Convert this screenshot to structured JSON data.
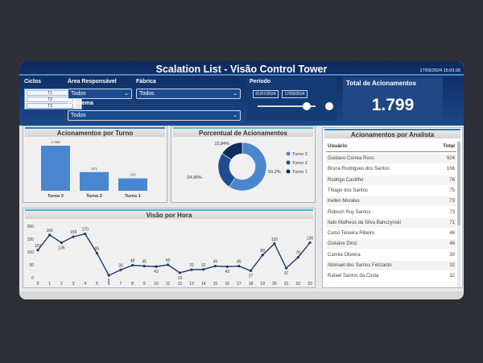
{
  "header": {
    "title": "Scalation List - Visão Control Tower",
    "timestamp": "17/09/2024 15:03:26"
  },
  "filters": {
    "ciclos_label": "Ciclos",
    "ciclos_items": [
      "T1",
      "T2",
      "T3"
    ],
    "area_label": "Área Responsável",
    "area_value": "Todos",
    "fabrica_label": "Fábrica",
    "fabrica_value": "Todos",
    "problema_label": "Problema",
    "problema_value": "Todos",
    "periodo_label": "Período",
    "periodo_start": "01/07/2024",
    "periodo_end": "17/09/2024"
  },
  "total": {
    "label": "Total de Acionamentos",
    "value": "1.799"
  },
  "panels": {
    "turno_title": "Acionamentos por Turno",
    "percent_title": "Porcentual de Acionamentos",
    "analista_title": "Acionamentos por Analista",
    "hora_title": "Visão por Hora"
  },
  "table": {
    "col_usuario": "Usuário",
    "col_total": "Total",
    "rows": [
      {
        "name": "Gustavo Correa Ross",
        "total": "924"
      },
      {
        "name": "Bruna Rodrigues dos Santos",
        "total": "166"
      },
      {
        "name": "Rodrigo Castilho",
        "total": "76"
      },
      {
        "name": "Thiago dos Santos",
        "total": "75"
      },
      {
        "name": "Kellen Morales",
        "total": "73"
      },
      {
        "name": "Robson Ruy Santos",
        "total": "73"
      },
      {
        "name": "Italo Matheus da Silva Banczynski",
        "total": "71"
      },
      {
        "name": "Celso Teixeira Ribeiro",
        "total": "46"
      },
      {
        "name": "Gislaine Diniz",
        "total": "46"
      },
      {
        "name": "Camila Oliveira",
        "total": "39"
      },
      {
        "name": "Abimael dos Santos Felizardo",
        "total": "32"
      },
      {
        "name": "Rafael Santos da Costa",
        "total": "32"
      }
    ]
  },
  "colors": {
    "dark_navy": "#0d2a5e",
    "bar_blue": "#4a86cf",
    "turno3": "#4a86cf",
    "turno2": "#1f4e8f",
    "turno1": "#0f2c5c",
    "line": "#1b3b6b"
  },
  "chart_data": [
    {
      "type": "bar",
      "categories": [
        "Turno 3",
        "Turno 2",
        "Turno 1"
      ],
      "values": [
        1065,
        441,
        293
      ],
      "value_labels": [
        "1.065",
        "441",
        "293"
      ]
    },
    {
      "type": "pie",
      "donut": true,
      "labels": [
        "Turno 3",
        "Turno 2",
        "Turno 1"
      ],
      "values": [
        59.2,
        24.96,
        15.84
      ],
      "value_labels": [
        "59,2%",
        "24,96%",
        "15,84%"
      ],
      "legend": "right"
    },
    {
      "type": "line",
      "x": [
        0,
        1,
        2,
        3,
        4,
        5,
        6,
        7,
        8,
        9,
        10,
        11,
        12,
        13,
        14,
        15,
        16,
        17,
        18,
        19,
        20,
        21,
        22,
        23
      ],
      "values": [
        107,
        166,
        136,
        159,
        170,
        95,
        9,
        30,
        48,
        45,
        43,
        50,
        19,
        31,
        32,
        45,
        43,
        45,
        27,
        88,
        132,
        37,
        79,
        136
      ],
      "ylim": [
        0,
        200
      ],
      "yticks": [
        0,
        50,
        100,
        150,
        200
      ]
    }
  ]
}
